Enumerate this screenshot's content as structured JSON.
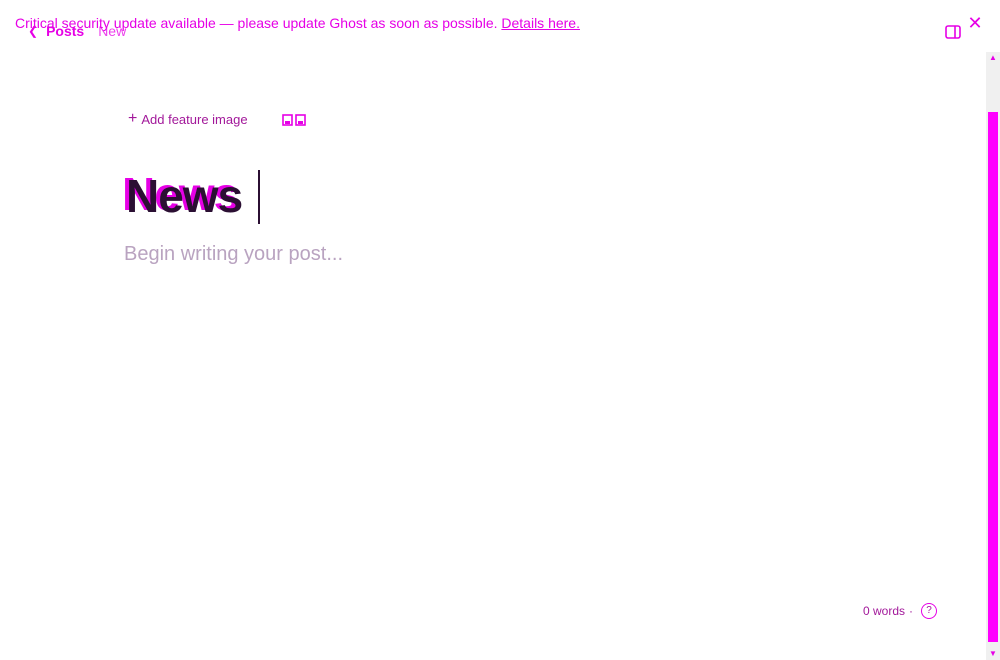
{
  "banner": {
    "message": "Critical security update available — please update Ghost as soon as possible.",
    "link": "Details here.",
    "close_icon": "close-icon"
  },
  "nav": {
    "back_icon": "chevron-left-icon",
    "posts": "Posts",
    "status": "New"
  },
  "toolbar": {
    "sidebar_icon": "sidebar-toggle-icon"
  },
  "editor": {
    "feature_plus": "+",
    "feature_label": "Add feature image",
    "gallery_icon": "image-gallery-icon",
    "title": "News",
    "placeholder": "Begin writing your post..."
  },
  "footer": {
    "word_count": "0 words",
    "separator": "·",
    "help": "?"
  },
  "colors": {
    "accent": "#e600e6",
    "title": "#2b0f33",
    "muted": "#b9a3c0"
  }
}
